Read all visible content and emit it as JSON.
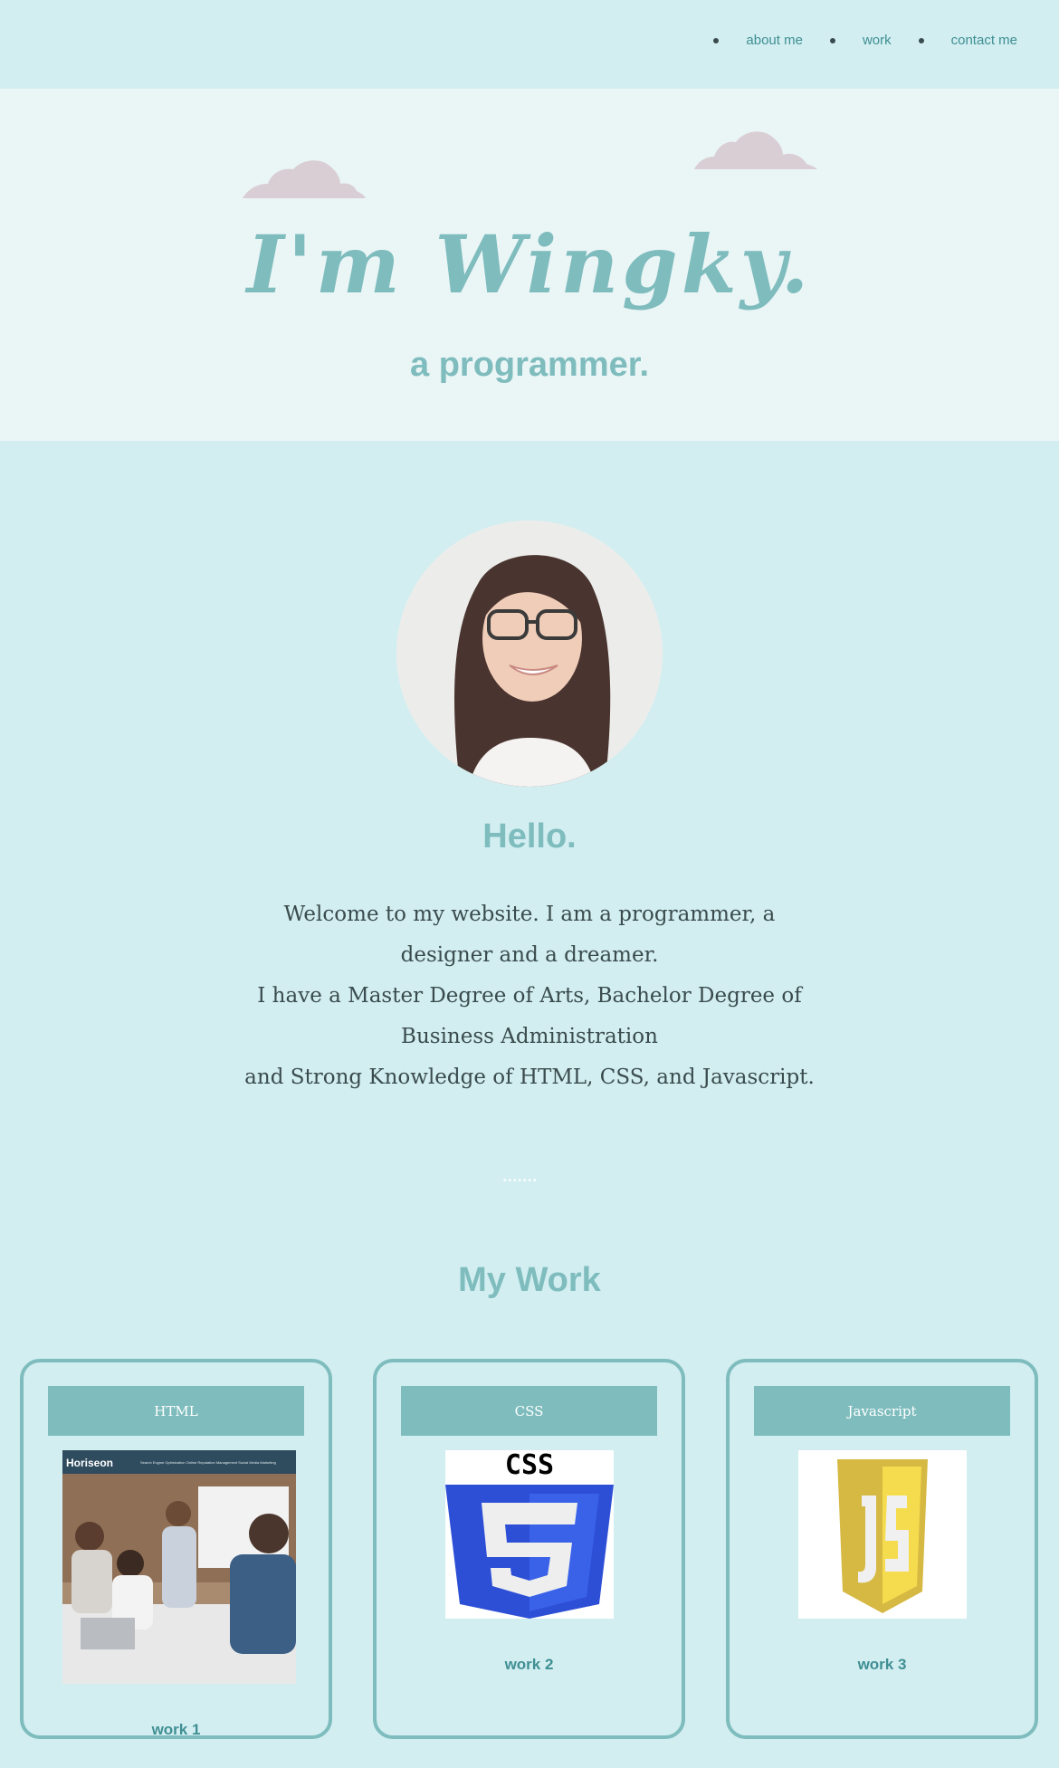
{
  "nav": {
    "items": [
      {
        "label": "about me"
      },
      {
        "label": "work"
      },
      {
        "label": "contact me"
      }
    ]
  },
  "hero": {
    "title": "I'm Wingky.",
    "subtitle": "a programmer."
  },
  "about": {
    "heading": "Hello.",
    "paragraph_lines": [
      "Welcome to my website. I am a programmer, a designer and a dreamer.",
      "I have a Master Degree of Arts, Bachelor Degree of Business Administration",
      "and Strong Knowledge of HTML, CSS, and Javascript."
    ],
    "divider": "•••••••"
  },
  "work": {
    "heading": "My Work",
    "cards": [
      {
        "header": "HTML",
        "label": "work 1",
        "thumb_caption": "Horiseon",
        "thumb_nav": "Search Engine Optimization   Online Reputation Management   Social Media Marketing"
      },
      {
        "header": "CSS",
        "label": "work 2",
        "thumb_caption": "CSS"
      },
      {
        "header": "Javascript",
        "label": "work 3"
      }
    ]
  },
  "colors": {
    "background": "#d2eef1",
    "hero_background": "#eaf5f6",
    "accent": "#7ebcbd",
    "link": "#3f8f93",
    "text": "#3a4b4d",
    "cloud": "#d9ced3"
  }
}
